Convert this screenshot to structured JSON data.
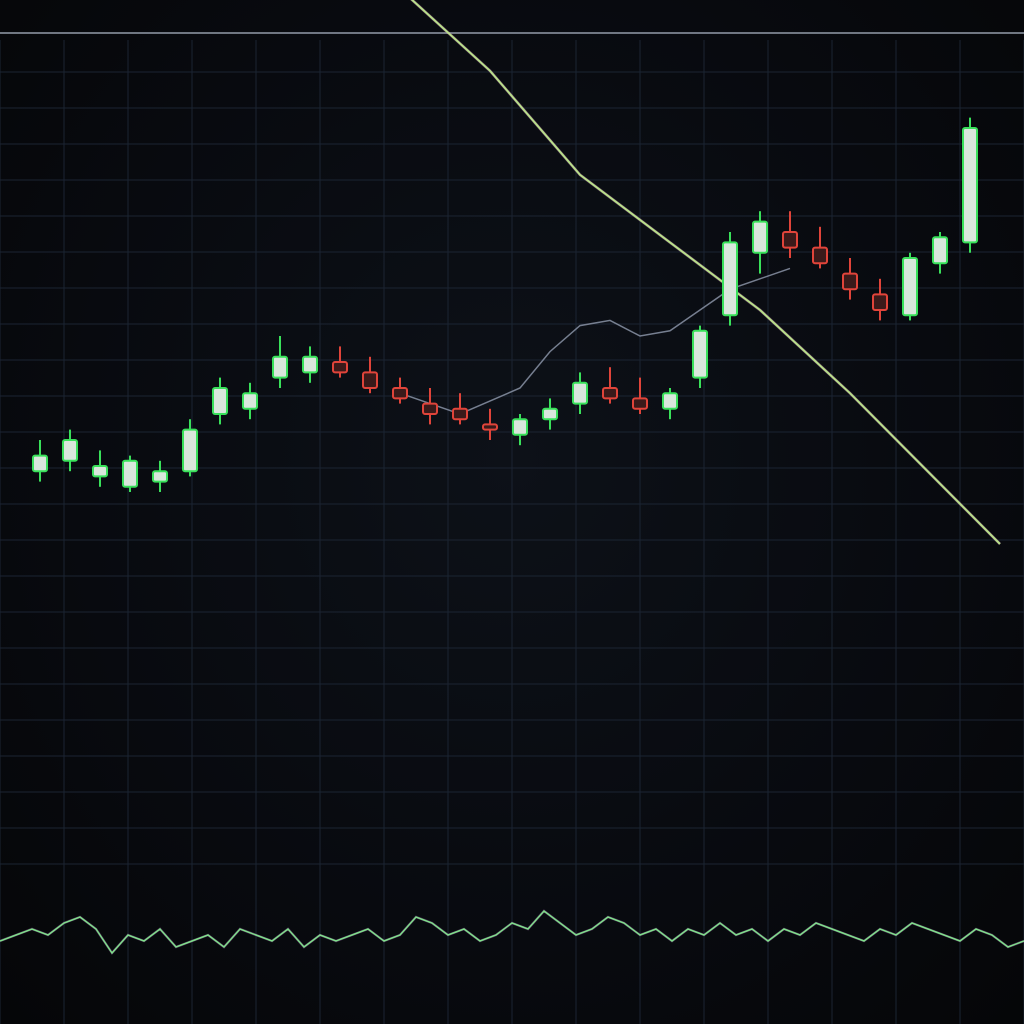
{
  "colors": {
    "background": "#07090d",
    "grid": "#1b2432",
    "up": "#39e05a",
    "down": "#e0443a",
    "body_light": "#d9e6dc",
    "price_line": "#8a93a6",
    "trend_line": "#b9e08a",
    "oscillator": "#7fe08a"
  },
  "chart_data": [
    {
      "type": "candlestick",
      "title": "",
      "xlabel": "",
      "ylabel": "",
      "grid": true,
      "ylim": [
        0,
        100
      ],
      "candles": [
        {
          "x": 1,
          "o": 44,
          "h": 50,
          "l": 42,
          "c": 47
        },
        {
          "x": 2,
          "o": 46,
          "h": 52,
          "l": 44,
          "c": 50
        },
        {
          "x": 3,
          "o": 43,
          "h": 48,
          "l": 41,
          "c": 45
        },
        {
          "x": 4,
          "o": 41,
          "h": 47,
          "l": 40,
          "c": 46
        },
        {
          "x": 5,
          "o": 42,
          "h": 46,
          "l": 40,
          "c": 44
        },
        {
          "x": 6,
          "o": 44,
          "h": 54,
          "l": 43,
          "c": 52
        },
        {
          "x": 7,
          "o": 55,
          "h": 62,
          "l": 53,
          "c": 60
        },
        {
          "x": 8,
          "o": 56,
          "h": 61,
          "l": 54,
          "c": 59
        },
        {
          "x": 9,
          "o": 62,
          "h": 70,
          "l": 60,
          "c": 66
        },
        {
          "x": 10,
          "o": 63,
          "h": 68,
          "l": 61,
          "c": 66
        },
        {
          "x": 11,
          "o": 65,
          "h": 68,
          "l": 62,
          "c": 63
        },
        {
          "x": 12,
          "o": 63,
          "h": 66,
          "l": 59,
          "c": 60
        },
        {
          "x": 13,
          "o": 60,
          "h": 62,
          "l": 57,
          "c": 58
        },
        {
          "x": 14,
          "o": 57,
          "h": 60,
          "l": 53,
          "c": 55
        },
        {
          "x": 15,
          "o": 56,
          "h": 59,
          "l": 53,
          "c": 54
        },
        {
          "x": 16,
          "o": 53,
          "h": 56,
          "l": 50,
          "c": 52
        },
        {
          "x": 17,
          "o": 51,
          "h": 55,
          "l": 49,
          "c": 54
        },
        {
          "x": 18,
          "o": 54,
          "h": 58,
          "l": 52,
          "c": 56
        },
        {
          "x": 19,
          "o": 57,
          "h": 63,
          "l": 55,
          "c": 61
        },
        {
          "x": 20,
          "o": 60,
          "h": 64,
          "l": 57,
          "c": 58
        },
        {
          "x": 21,
          "o": 58,
          "h": 62,
          "l": 55,
          "c": 56
        },
        {
          "x": 22,
          "o": 56,
          "h": 60,
          "l": 54,
          "c": 59
        },
        {
          "x": 23,
          "o": 62,
          "h": 72,
          "l": 60,
          "c": 71
        },
        {
          "x": 24,
          "o": 74,
          "h": 90,
          "l": 72,
          "c": 88
        },
        {
          "x": 25,
          "o": 86,
          "h": 94,
          "l": 82,
          "c": 92
        },
        {
          "x": 26,
          "o": 90,
          "h": 94,
          "l": 85,
          "c": 87
        },
        {
          "x": 27,
          "o": 87,
          "h": 91,
          "l": 83,
          "c": 84
        },
        {
          "x": 28,
          "o": 82,
          "h": 85,
          "l": 77,
          "c": 79
        },
        {
          "x": 29,
          "o": 78,
          "h": 81,
          "l": 73,
          "c": 75
        },
        {
          "x": 30,
          "o": 74,
          "h": 86,
          "l": 73,
          "c": 85
        },
        {
          "x": 31,
          "o": 84,
          "h": 90,
          "l": 82,
          "c": 89
        },
        {
          "x": 32,
          "o": 88,
          "h": 112,
          "l": 86,
          "c": 110
        }
      ],
      "price_line": [
        {
          "x": 13,
          "y": 59
        },
        {
          "x": 15,
          "y": 55
        },
        {
          "x": 17,
          "y": 60
        },
        {
          "x": 18,
          "y": 67
        },
        {
          "x": 19,
          "y": 72
        },
        {
          "x": 20,
          "y": 73
        },
        {
          "x": 21,
          "y": 70
        },
        {
          "x": 22,
          "y": 71
        },
        {
          "x": 23,
          "y": 75
        },
        {
          "x": 24,
          "y": 79
        },
        {
          "x": 25,
          "y": 81
        },
        {
          "x": 26,
          "y": 83
        }
      ],
      "trend_line": [
        {
          "x": 9.0,
          "y": 160
        },
        {
          "x": 12.0,
          "y": 142
        },
        {
          "x": 16.0,
          "y": 121
        },
        {
          "x": 19.0,
          "y": 101
        },
        {
          "x": 22.0,
          "y": 88
        },
        {
          "x": 25.0,
          "y": 75
        },
        {
          "x": 28.0,
          "y": 59
        },
        {
          "x": 33.0,
          "y": 30
        }
      ]
    },
    {
      "type": "line",
      "title": "",
      "xlabel": "",
      "ylabel": "",
      "grid": false,
      "ylim": [
        0,
        10
      ],
      "x": [
        0,
        1,
        2,
        3,
        4,
        5,
        6,
        7,
        8,
        9,
        10,
        11,
        12,
        13,
        14,
        15,
        16,
        17,
        18,
        19,
        20,
        21,
        22,
        23,
        24,
        25,
        26,
        27,
        28,
        29,
        30,
        31,
        32,
        33,
        34,
        35,
        36,
        37,
        38,
        39,
        40,
        41,
        42,
        43,
        44,
        45,
        46,
        47,
        48,
        49,
        50,
        51,
        52,
        53,
        54,
        55,
        56,
        57,
        58,
        59,
        60,
        61,
        62,
        63,
        64
      ],
      "series": [
        {
          "values": [
            4,
            5,
            6,
            5,
            7,
            8,
            6,
            2,
            5,
            4,
            6,
            3,
            4,
            5,
            3,
            6,
            5,
            4,
            6,
            3,
            5,
            4,
            5,
            6,
            4,
            5,
            8,
            7,
            5,
            6,
            4,
            5,
            7,
            6,
            9,
            7,
            5,
            6,
            8,
            7,
            5,
            6,
            4,
            6,
            5,
            7,
            5,
            6,
            4,
            6,
            5,
            7,
            6,
            5,
            4,
            6,
            5,
            7,
            6,
            5,
            4,
            6,
            5,
            3,
            4
          ]
        }
      ]
    }
  ]
}
